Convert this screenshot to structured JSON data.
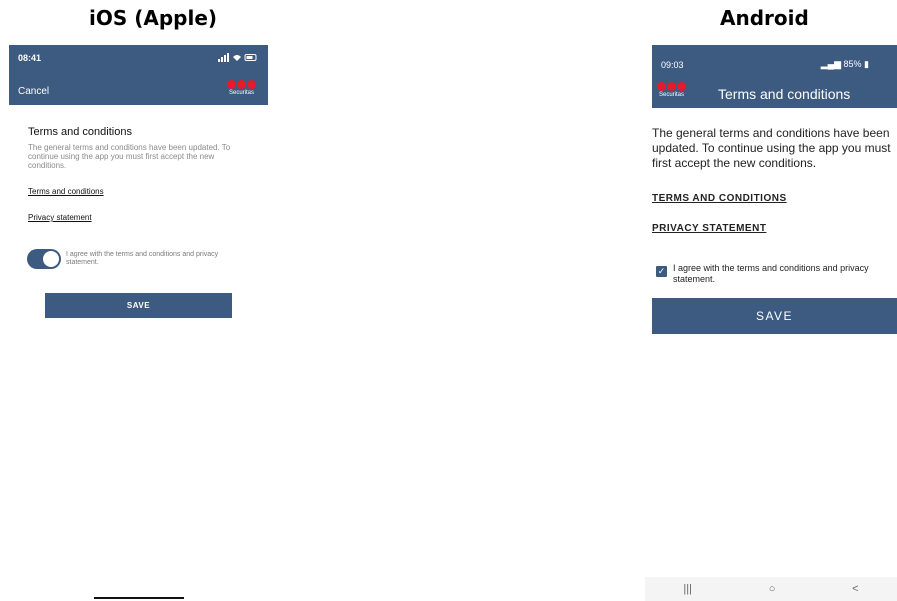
{
  "headings": {
    "ios": "iOS (Apple)",
    "android": "Android"
  },
  "brand": {
    "logo_word": "Securitas",
    "dot_color": "#e8192c",
    "bar_color": "#3d5a80"
  },
  "ios": {
    "status_time": "08:41",
    "status_icons": "signal wifi battery",
    "cancel_label": "Cancel",
    "title": "Terms and conditions",
    "description": "The general terms and conditions have been updated. To continue using the app you must first accept the new conditions.",
    "terms_link": "Terms and conditions",
    "privacy_link": "Privacy statement",
    "agree_text": "I agree with the terms and conditions and privacy statement.",
    "agree_on": true,
    "save_label": "SAVE"
  },
  "android": {
    "status_time": "09:03",
    "status_battery": "85%",
    "title": "Terms and conditions",
    "description": "The general terms and conditions have been updated. To continue using the app you must first accept the new conditions.",
    "terms_link": "TERMS AND CONDITIONS",
    "privacy_link": "PRIVACY STATEMENT",
    "agree_text": "I agree with the terms and conditions and privacy statement.",
    "agree_checked": true,
    "save_label": "SAVE",
    "nav": {
      "recents": "|||",
      "home": "○",
      "back": "<"
    }
  }
}
